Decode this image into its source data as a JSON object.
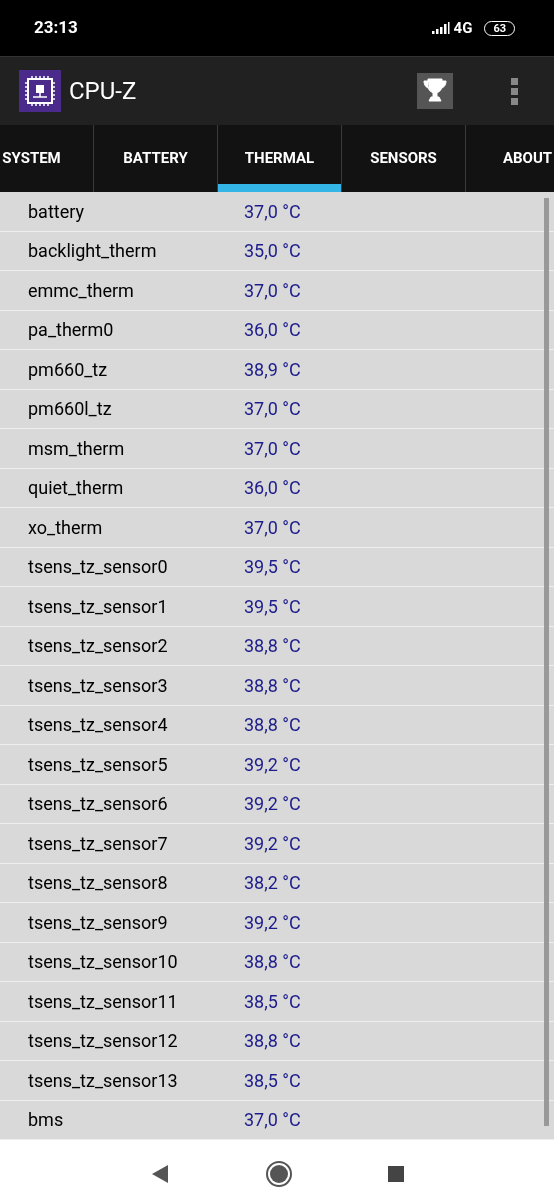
{
  "status_bar": {
    "time": "23:13",
    "network": "4G",
    "battery": "63"
  },
  "app_bar": {
    "title": "CPU-Z"
  },
  "tabs": [
    {
      "label": "SYSTEM",
      "selected": false
    },
    {
      "label": "BATTERY",
      "selected": false
    },
    {
      "label": "THERMAL",
      "selected": true
    },
    {
      "label": "SENSORS",
      "selected": false
    },
    {
      "label": "ABOUT",
      "selected": false
    }
  ],
  "rows": [
    {
      "name": "battery",
      "value": "37,0 °C"
    },
    {
      "name": "backlight_therm",
      "value": "35,0 °C"
    },
    {
      "name": "emmc_therm",
      "value": "37,0 °C"
    },
    {
      "name": "pa_therm0",
      "value": "36,0 °C"
    },
    {
      "name": "pm660_tz",
      "value": "38,9 °C"
    },
    {
      "name": "pm660l_tz",
      "value": "37,0 °C"
    },
    {
      "name": "msm_therm",
      "value": "37,0 °C"
    },
    {
      "name": "quiet_therm",
      "value": "36,0 °C"
    },
    {
      "name": "xo_therm",
      "value": "37,0 °C"
    },
    {
      "name": "tsens_tz_sensor0",
      "value": "39,5 °C"
    },
    {
      "name": "tsens_tz_sensor1",
      "value": "39,5 °C"
    },
    {
      "name": "tsens_tz_sensor2",
      "value": "38,8 °C"
    },
    {
      "name": "tsens_tz_sensor3",
      "value": "38,8 °C"
    },
    {
      "name": "tsens_tz_sensor4",
      "value": "38,8 °C"
    },
    {
      "name": "tsens_tz_sensor5",
      "value": "39,2 °C"
    },
    {
      "name": "tsens_tz_sensor6",
      "value": "39,2 °C"
    },
    {
      "name": "tsens_tz_sensor7",
      "value": "39,2 °C"
    },
    {
      "name": "tsens_tz_sensor8",
      "value": "38,2 °C"
    },
    {
      "name": "tsens_tz_sensor9",
      "value": "39,2 °C"
    },
    {
      "name": "tsens_tz_sensor10",
      "value": "38,8 °C"
    },
    {
      "name": "tsens_tz_sensor11",
      "value": "38,5 °C"
    },
    {
      "name": "tsens_tz_sensor12",
      "value": "38,8 °C"
    },
    {
      "name": "tsens_tz_sensor13",
      "value": "38,5 °C"
    },
    {
      "name": "bms",
      "value": "37,0 °C"
    }
  ]
}
